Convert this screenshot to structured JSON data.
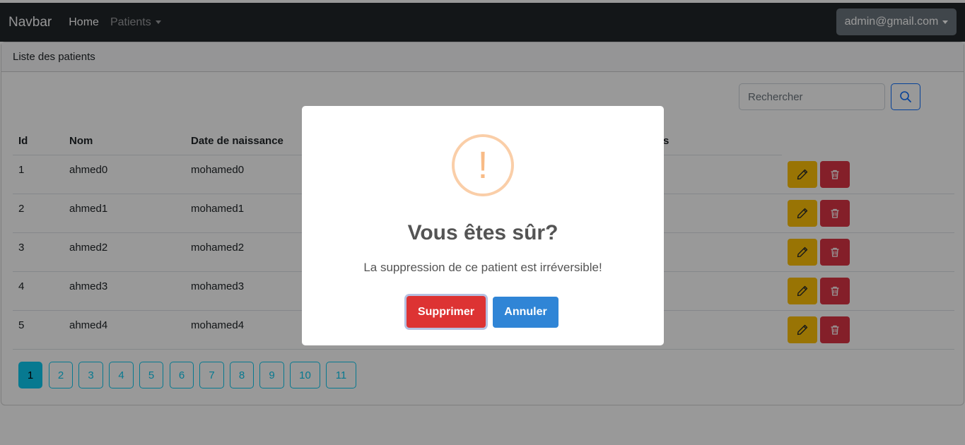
{
  "navbar": {
    "brand": "Navbar",
    "home": "Home",
    "patients": "Patients",
    "user": "admin@gmail.com"
  },
  "card": {
    "header": "Liste des patients",
    "search_placeholder": "Rechercher"
  },
  "table": {
    "headers": [
      "Id",
      "Nom",
      "Date de naissance",
      "s"
    ],
    "rows": [
      {
        "id": "1",
        "nom": "ahmed0",
        "date": "mohamed0"
      },
      {
        "id": "2",
        "nom": "ahmed1",
        "date": "mohamed1"
      },
      {
        "id": "3",
        "nom": "ahmed2",
        "date": "mohamed2"
      },
      {
        "id": "4",
        "nom": "ahmed3",
        "date": "mohamed3"
      },
      {
        "id": "5",
        "nom": "ahmed4",
        "date": "mohamed4"
      }
    ]
  },
  "pagination": {
    "pages": [
      "1",
      "2",
      "3",
      "4",
      "5",
      "6",
      "7",
      "8",
      "9",
      "10",
      "11"
    ],
    "active": "1"
  },
  "modal": {
    "icon_symbol": "!",
    "title": "Vous êtes sûr?",
    "text": "La suppression de ce patient est irréversible!",
    "confirm": "Supprimer",
    "cancel": "Annuler"
  },
  "colors": {
    "warning": "#ffc107",
    "danger": "#dc3545",
    "info": "#0dcaf0",
    "confirm": "#dd3333",
    "cancel": "#3085d6"
  }
}
